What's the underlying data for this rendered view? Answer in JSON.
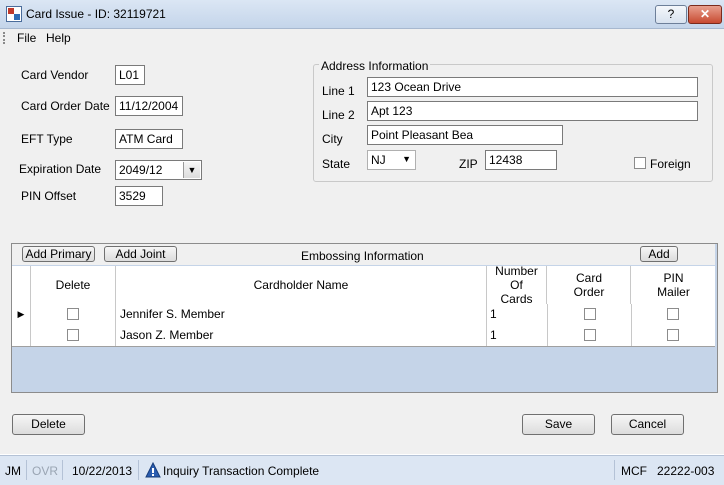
{
  "window": {
    "title": "Card Issue - ID: 32119721",
    "help_label": "?",
    "close_label": "✕"
  },
  "menu": {
    "items": [
      "File",
      "Help"
    ]
  },
  "card": {
    "vendor_label": "Card Vendor",
    "vendor_value": "L01",
    "order_date_label": "Card Order Date",
    "order_date_value": "11/12/2004",
    "eft_label": "EFT Type",
    "eft_value": "ATM Card",
    "expiration_label": "Expiration Date",
    "expiration_value": "2049/12",
    "pin_label": "PIN Offset",
    "pin_value": "3529"
  },
  "address": {
    "group_title": "Address Information",
    "line1_label": "Line 1",
    "line1_value": "123 Ocean Drive",
    "line2_label": "Line 2",
    "line2_value": "Apt 123",
    "city_label": "City",
    "city_value": "Point Pleasant Bea",
    "state_label": "State",
    "state_value": "NJ",
    "zip_label": "ZIP",
    "zip_value": "12438",
    "foreign_label": "Foreign",
    "foreign_checked": false
  },
  "embossing": {
    "add_primary_label": "Add Primary",
    "add_joint_label": "Add Joint",
    "title": "Embossing Information",
    "add_label": "Add",
    "columns": {
      "delete": "Delete",
      "name": "Cardholder Name",
      "num_cards": "Number Of Cards",
      "card_order": "Card Order",
      "pin_mailer": "PIN Mailer"
    },
    "rows": [
      {
        "name": "Jennifer S. Member",
        "num_cards": "1"
      },
      {
        "name": "Jason Z. Member",
        "num_cards": "1"
      }
    ]
  },
  "buttons": {
    "delete_label": "Delete",
    "save_label": "Save",
    "cancel_label": "Cancel"
  },
  "status": {
    "user": "JM",
    "ovr": "OVR",
    "date": "10/22/2013",
    "message": "Inquiry Transaction Complete",
    "mcf": "MCF",
    "code": "22222-003"
  },
  "colors": {
    "grid_background": "#c5d4e8",
    "status_bar": "#dce6f3",
    "title_bar": "#c4d5ea"
  },
  "icons": {
    "status_icon": "warning-triangle-icon",
    "app_icon": "app-icon",
    "row_indicator": "row-pointer-icon"
  }
}
